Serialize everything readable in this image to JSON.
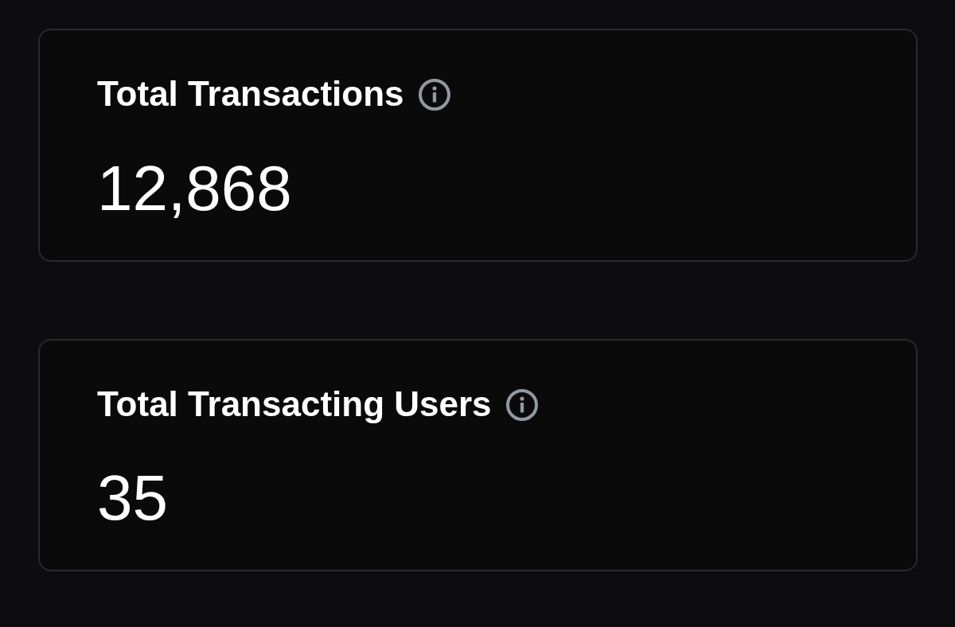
{
  "cards": [
    {
      "title": "Total Transactions",
      "value": "12,868"
    },
    {
      "title": "Total Transacting Users",
      "value": "35"
    }
  ]
}
